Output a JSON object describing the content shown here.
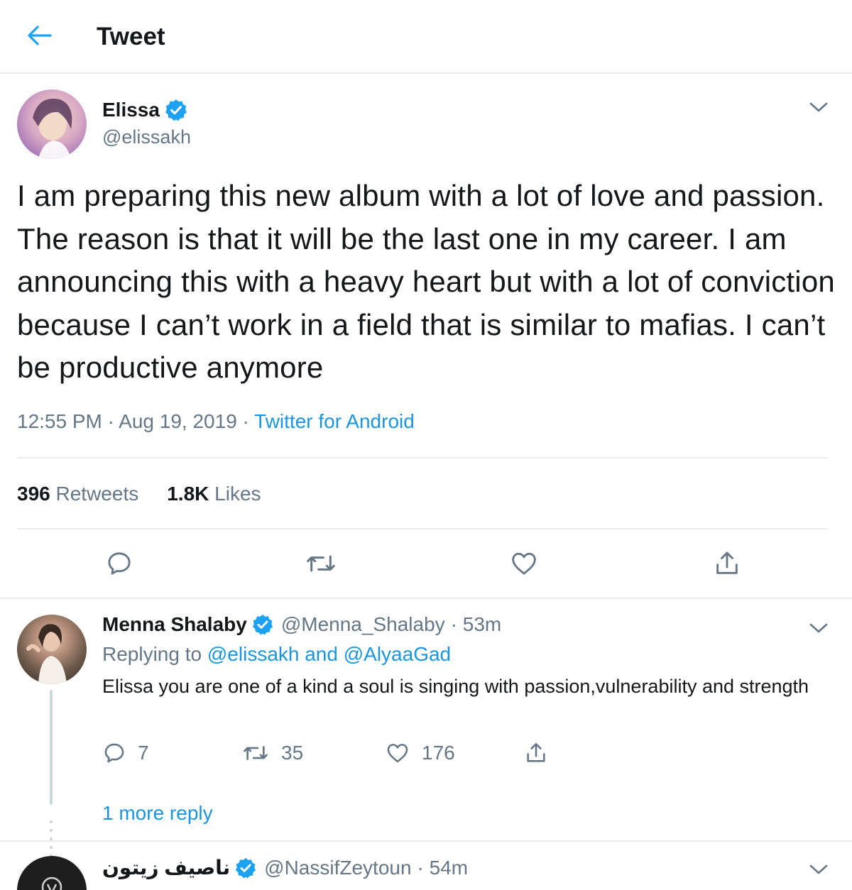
{
  "header": {
    "title": "Tweet"
  },
  "tweet": {
    "author": {
      "name": "Elissa",
      "handle": "@elissakh"
    },
    "text": "I am preparing this new album with a lot of love and passion. The reason is that it will be the last one in my career. I am announcing this with a heavy heart but with a lot of conviction because I can’t work in a field that is similar to mafias. I can’t be productive anymore",
    "time": "12:55 PM · Aug 19, 2019 · ",
    "source": "Twitter for Android",
    "retweets_count": "396",
    "retweets_label": "Retweets",
    "likes_count": "1.8K",
    "likes_label": "Likes"
  },
  "replies": [
    {
      "name": "Menna Shalaby",
      "handle": "@Menna_Shalaby",
      "time": "· 53m",
      "replying_label": "Replying to ",
      "replying_to": "@elissakh and @AlyaaGad",
      "text": "Elissa you are one of a kind a soul is singing with passion,vulnerability and strength",
      "reply_count": "7",
      "retweet_count": "35",
      "like_count": "176",
      "more_replies": "1 more reply"
    },
    {
      "name": "ناصيف زيتون",
      "handle": "@NassifZeytoun",
      "time": "· 54m"
    }
  ],
  "colors": {
    "accent": "#1b95e0",
    "secondary_text": "#657786",
    "verified": "#1da1f2",
    "divider": "#e6ecf0"
  },
  "icons": [
    "back-arrow-icon",
    "verified-badge-icon",
    "chevron-down-icon",
    "reply-icon",
    "retweet-icon",
    "like-icon",
    "share-icon"
  ]
}
